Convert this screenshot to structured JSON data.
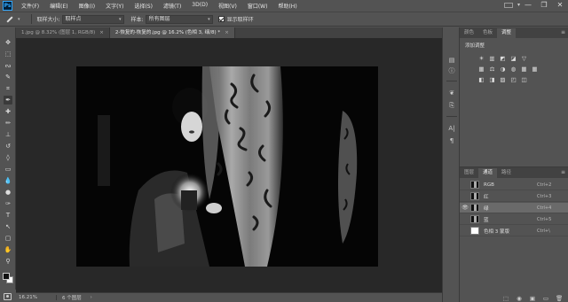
{
  "app": {
    "logo": "Ps"
  },
  "menu": [
    "文件(F)",
    "编辑(E)",
    "图像(I)",
    "文字(Y)",
    "选择(S)",
    "滤镜(T)",
    "3D(D)",
    "视图(V)",
    "窗口(W)",
    "帮助(H)"
  ],
  "window_controls": {
    "minimize": "—",
    "maximize": "❐",
    "close": "✕"
  },
  "options": {
    "sample_size_label": "取样大小:",
    "sample_size_value": "取样点",
    "sample_label": "样本:",
    "sample_value": "所有图层",
    "show_ring_label": "显示取样环",
    "show_ring_checked": true
  },
  "tabs": [
    {
      "label": "1.jpg @ 8.32% (图层 1, RGB/8)",
      "close": "×",
      "active": false
    },
    {
      "label": "2-恢复的-恢复的.jpg @ 16.2% (色相 3, 绿/8) *",
      "close": "×",
      "active": true
    }
  ],
  "tools": [
    "move-icon",
    "marquee-icon",
    "lasso-icon",
    "quick-select-icon",
    "crop-icon",
    "eyedropper-icon",
    "spot-heal-icon",
    "brush-icon",
    "clone-stamp-icon",
    "history-brush-icon",
    "eraser-icon",
    "gradient-icon",
    "blur-icon",
    "dodge-icon",
    "pen-icon",
    "type-icon",
    "path-select-icon",
    "rectangle-icon",
    "hand-icon",
    "zoom-icon",
    "more-tools-icon"
  ],
  "tool_glyphs": [
    "✥",
    "⬚",
    "ᔓ",
    "✎",
    "⌗",
    "✒",
    "✚",
    "✏",
    "⊥",
    "↺",
    "◊",
    "▭",
    "💧",
    "●",
    "✑",
    "T",
    "↖",
    "▢",
    "✋",
    "⚲",
    "···"
  ],
  "active_tool_index": 5,
  "status": {
    "zoom": "16.21%",
    "info": "6 个图层",
    "arrow": "›"
  },
  "mid_dock_icons": [
    "histogram-icon",
    "info-icon",
    "brush-preset-icon",
    "clone-source-icon",
    "character-icon",
    "paragraph-icon"
  ],
  "mid_dock_glyphs": [
    "▤",
    "ⓘ",
    "❦",
    "⎘",
    "A|",
    "¶"
  ],
  "adjustments_panel": {
    "tabs": [
      "颜色",
      "色板",
      "调整"
    ],
    "active_tab": 2,
    "menu": "≡",
    "title": "添加调整",
    "rows": [
      [
        "☀",
        "▥",
        "◩",
        "◪",
        "▽"
      ],
      [
        "▦",
        "⚖",
        "◑",
        "◍",
        "▦",
        "▦"
      ],
      [
        "◧",
        "◨",
        "▨",
        "◰",
        "◫"
      ]
    ]
  },
  "channels_panel": {
    "tabs": [
      "图层",
      "通道",
      "路径"
    ],
    "active_tab": 1,
    "menu": "≡",
    "rows": [
      {
        "name": "RGB",
        "shortcut": "Ctrl+2",
        "visible": false,
        "selected": false,
        "thumb": "dark"
      },
      {
        "name": "红",
        "shortcut": "Ctrl+3",
        "visible": false,
        "selected": false,
        "thumb": "dark"
      },
      {
        "name": "绿",
        "shortcut": "Ctrl+4",
        "visible": true,
        "selected": true,
        "thumb": "dark"
      },
      {
        "name": "蓝",
        "shortcut": "Ctrl+5",
        "visible": false,
        "selected": false,
        "thumb": "dark"
      },
      {
        "name": "色相 3 蒙版",
        "shortcut": "Ctrl+\\",
        "visible": false,
        "selected": false,
        "thumb": "white"
      }
    ],
    "eye_glyph": "👁",
    "bottom_buttons": [
      "⬚",
      "◉",
      "▣",
      "▭",
      "🗑"
    ]
  }
}
